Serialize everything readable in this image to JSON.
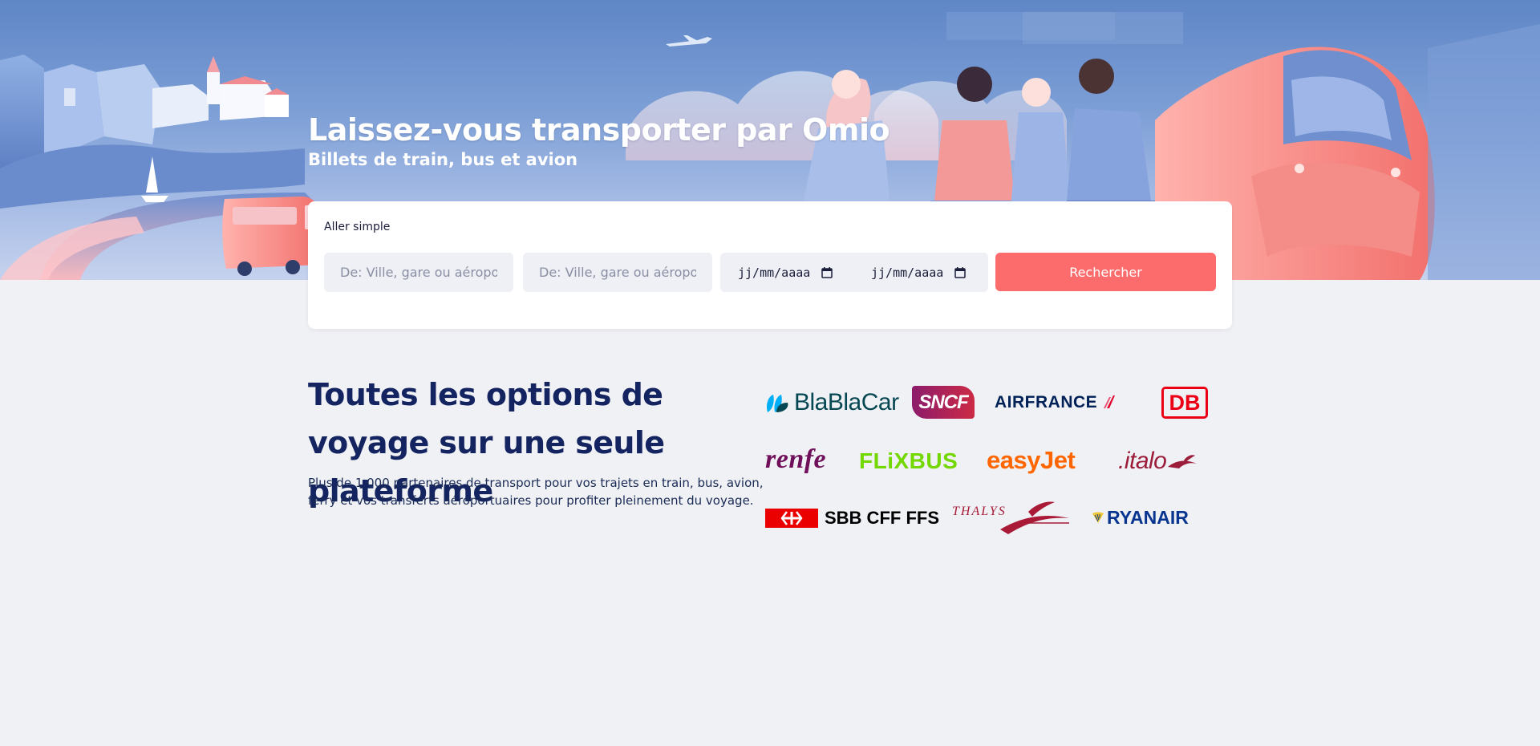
{
  "hero": {
    "title": "Laissez-vous transporter par Omio",
    "subtitle": "Billets de train, bus et avion"
  },
  "search": {
    "trip_type": "Aller simple",
    "from_placeholder": "De: Ville, gare ou aéroport",
    "to_placeholder": "De: Ville, gare ou aéroport",
    "departure_date": "jj/mm/aaaa",
    "return_date": "jj/mm/aaaa",
    "submit_label": "Rechercher",
    "submit_color": "#fc6c6c"
  },
  "partners": {
    "title": "Toutes les options de voyage sur une seule plateforme",
    "description": "Plus de 1 000 partenaires de transport pour vos trajets en train, bus, avion, ferry et vos transferts aéroportuaires pour profiter pleinement du voyage.",
    "logos": [
      {
        "name": "BlaBlaCar",
        "text": "BlaBlaCar",
        "color": "#054752"
      },
      {
        "name": "SNCF",
        "text": "SNCF",
        "color": "#b02660"
      },
      {
        "name": "Air France",
        "text": "AIRFRANCE",
        "color": "#002157"
      },
      {
        "name": "DB",
        "text": "DB",
        "color": "#ec0016"
      },
      {
        "name": "Renfe",
        "text": "renfe",
        "color": "#70105a"
      },
      {
        "name": "FlixBus",
        "text": "FLiXBUS",
        "color": "#73d700"
      },
      {
        "name": "easyJet",
        "text": "easyJet",
        "color": "#ff6600"
      },
      {
        "name": "Italo",
        "text": ".italo",
        "color": "#9b1d3a"
      },
      {
        "name": "SBB CFF FFS",
        "text": "SBB CFF FFS",
        "color": "#eb0000"
      },
      {
        "name": "Thalys",
        "text": "THALYS",
        "color": "#a81a36"
      },
      {
        "name": "Ryanair",
        "text": "RYANAIR",
        "color": "#073590"
      }
    ]
  }
}
